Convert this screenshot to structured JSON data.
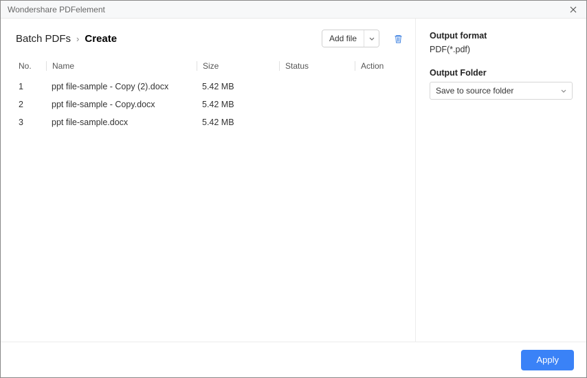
{
  "window": {
    "title": "Wondershare PDFelement"
  },
  "breadcrumb": {
    "root": "Batch PDFs",
    "current": "Create"
  },
  "toolbar": {
    "add_file_label": "Add file"
  },
  "table": {
    "headers": {
      "no": "No.",
      "name": "Name",
      "size": "Size",
      "status": "Status",
      "action": "Action"
    },
    "rows": [
      {
        "no": "1",
        "name": "ppt file-sample - Copy (2).docx",
        "size": "5.42 MB",
        "status": "",
        "action": ""
      },
      {
        "no": "2",
        "name": "ppt file-sample - Copy.docx",
        "size": "5.42 MB",
        "status": "",
        "action": ""
      },
      {
        "no": "3",
        "name": "ppt file-sample.docx",
        "size": "5.42 MB",
        "status": "",
        "action": ""
      }
    ]
  },
  "sidebar": {
    "output_format_label": "Output format",
    "output_format_value": "PDF(*.pdf)",
    "output_folder_label": "Output Folder",
    "output_folder_value": "Save to source folder"
  },
  "footer": {
    "apply_label": "Apply"
  }
}
